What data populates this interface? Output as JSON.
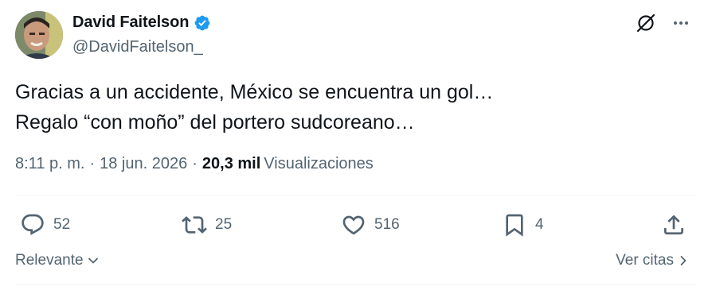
{
  "author": {
    "display_name": "David Faitelson",
    "handle": "@DavidFaitelson_",
    "verified": true
  },
  "tweet": {
    "lines": [
      "Gracias a un accidente, México se encuentra un gol…",
      "Regalo “con moño” del portero sudcoreano…"
    ]
  },
  "meta": {
    "time": "8:11 p. m.",
    "separator": "·",
    "date": "18 jun. 2026",
    "views_count": "20,3 mil",
    "views_label": "Visualizaciones"
  },
  "actions": {
    "replies": "52",
    "reposts": "25",
    "likes": "516",
    "bookmarks": "4"
  },
  "footer": {
    "sort_label": "Relevante",
    "quotes_link": "Ver citas"
  },
  "colors": {
    "text_primary": "#0f1419",
    "text_secondary": "#536471",
    "verified_blue": "#1d9bf0",
    "divider": "#eff3f4"
  },
  "icons": {
    "top_right": [
      "grok-icon",
      "more-icon"
    ],
    "action_bar": [
      "reply-icon",
      "repost-icon",
      "like-icon",
      "bookmark-icon",
      "share-icon"
    ]
  }
}
